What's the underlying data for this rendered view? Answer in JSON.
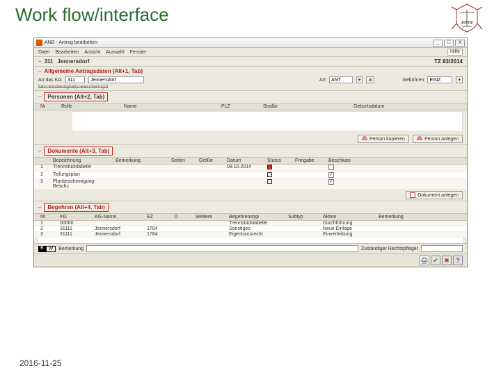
{
  "slide": {
    "title": "Work flow/interface",
    "footer_date": "2016-11-25"
  },
  "window": {
    "title": "ANB - Antrag bearbeiten",
    "help_label": "Hilfe"
  },
  "menu": {
    "datei": "Datei",
    "bearbeiten": "Bearbeiten",
    "ansicht": "Ansicht",
    "auswahl": "Auswahl",
    "fenster": "Fenster"
  },
  "header": {
    "code": "311",
    "ort": "Jennersdorf",
    "tz_label": "TZ",
    "tz_value": "83/2014"
  },
  "section_antrag": {
    "title": "Allgemeine Antragsdaten (Alt+1, Tab)",
    "label_an_kg": "An das KG",
    "val_an_kg_code": "311",
    "val_an_kg_name": "Jennersdorf",
    "label_art": "Art",
    "val_art": "ANT",
    "label_gebuehren": "Gebühren",
    "val_gebuehren": "EINZ",
    "strike_text": "kein Eindeutigkeits-Bescheinigid"
  },
  "section_personen": {
    "title": "Personen (Alt+2, Tab)",
    "cols": [
      "Nr",
      "Rolle",
      "Name",
      "PLZ",
      "Straße",
      "Geburtsdatum"
    ],
    "btn_copy": "Person kopieren",
    "btn_new": "Person anlegen"
  },
  "section_dokumente": {
    "title": "Dokumente (Alt+3, Tab)",
    "cols": [
      "",
      "Bezeichnung",
      "Bemerkung",
      "Seiten",
      "Größe",
      "Datum",
      "Status",
      "Freigabe",
      "Beschluss"
    ],
    "rows": [
      {
        "nr": "1",
        "bez": "Trennstücktabelle",
        "bem": "",
        "seiten": "",
        "groesse": "",
        "datum": "09.10.2014",
        "status": "red",
        "chk": false
      },
      {
        "nr": "2",
        "bez": "Teilungsplan",
        "bem": "",
        "seiten": "",
        "groesse": "",
        "datum": "",
        "status": "file",
        "chk": true
      },
      {
        "nr": "3",
        "bez": "Planbescheinigung-Beschc",
        "bem": "",
        "seiten": "",
        "groesse": "",
        "datum": "",
        "status": "file",
        "chk": true
      }
    ],
    "btn_new": "Dokument anlegen"
  },
  "section_begehren": {
    "title": "Begehren (Alt+4, Tab)",
    "cols": [
      "Nr",
      "KG",
      "KG-Name",
      "EZ",
      "0",
      "Weitere",
      "Begehrenstyp",
      "Subtyp",
      "Aktion",
      "Bemerkung"
    ],
    "rows": [
      {
        "nr": "1",
        "kg": "00000",
        "kgn": "",
        "ez": "",
        "w": "",
        "typ": "Trennstücktabelle",
        "sub": "",
        "akt": "Durchführung"
      },
      {
        "nr": "2",
        "kg": "31111",
        "kgn": "Jennersdorf",
        "ez": "1784",
        "w": "",
        "typ": "Sonstiges",
        "sub": "",
        "akt": "Neue Einlage"
      },
      {
        "nr": "3",
        "kg": "31111",
        "kgn": "Jennersdorf",
        "ez": "1784",
        "w": "",
        "typ": "Eigentumsrecht",
        "sub": "",
        "akt": "Einverleibung"
      }
    ]
  },
  "bottom": {
    "bw_b": "B",
    "bw_w": "W",
    "bemerkung_label": "Bemerkung",
    "zust_label": "Zuständiger Rechtspfleger"
  }
}
